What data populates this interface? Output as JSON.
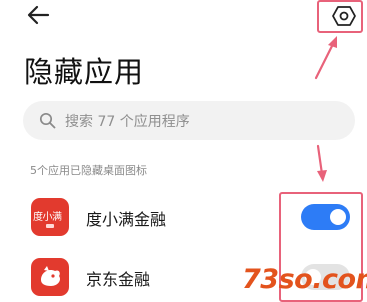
{
  "page": {
    "title": "隐藏应用"
  },
  "search": {
    "placeholder": "搜索 77 个应用程序"
  },
  "section": {
    "label": "5个应用已隐藏桌面图标"
  },
  "apps": [
    {
      "name": "度小满金融",
      "icon_text": "度小满",
      "icon_color": "#e23a2e",
      "hidden": true
    },
    {
      "name": "京东金融",
      "icon_color": "#e23a2e",
      "hidden": false
    }
  ],
  "colors": {
    "accent": "#2d7cf6",
    "toggle_off": "#e3e3e3",
    "annotation": "#e8627a"
  },
  "watermark": {
    "text": "73so.com"
  },
  "icons": {
    "back": "back-arrow-icon",
    "settings": "settings-gear-icon",
    "search": "search-icon"
  }
}
